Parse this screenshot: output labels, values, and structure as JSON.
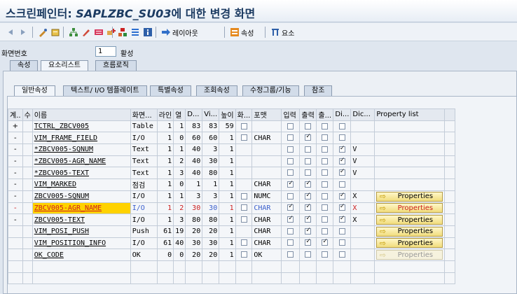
{
  "window": {
    "title_prefix": "스크린페인터:",
    "title_program": "SAPLZBC_SU03",
    "title_suffix": "에 대한 변경 화면"
  },
  "toolbar": {
    "layout_label": "레이아웃",
    "attributes_label": "속성",
    "elements_label": "요소"
  },
  "screen": {
    "number_label": "화면번호",
    "number_value": "1",
    "status": "활성"
  },
  "main_tabs": [
    "속성",
    "요소리스트",
    "흐름로직"
  ],
  "sub_tabs": [
    "일반속성",
    "텍스트/ I/O 템플레이트",
    "특별속성",
    "조회속성",
    "수정그룹/기능",
    "참조"
  ],
  "columns": [
    "계..",
    "수",
    "이름",
    "화면...",
    "라인",
    "열",
    "D...",
    "Vi...",
    "높이",
    "화...",
    "포맷",
    "입력",
    "출력",
    "출...",
    "Di...",
    "Dic...",
    "Property list"
  ],
  "property_button_label": "Properties",
  "rows": [
    {
      "mark": "+",
      "name": "TCTRL_ZBCV005",
      "type": "Table",
      "line": "1",
      "col": "1",
      "d": "83",
      "vi": "83",
      "h": "59",
      "hw": false,
      "fmt": "",
      "inp": false,
      "out": false,
      "oo": false,
      "di": false,
      "dic": "",
      "props": false
    },
    {
      "mark": "-",
      "name": "VIM_FRAME_FIELD",
      "type": "I/O",
      "line": "1",
      "col": "0",
      "d": "60",
      "vi": "60",
      "h": "1",
      "hw": false,
      "fmt": "CHAR",
      "inp": false,
      "out": true,
      "oo": false,
      "di": false,
      "dic": "",
      "props": false
    },
    {
      "mark": "-",
      "name": "*ZBCV005-SQNUM",
      "type": "Text",
      "line": "1",
      "col": "1",
      "d": "40",
      "vi": "3",
      "h": "1",
      "hw": null,
      "fmt": "",
      "inp": false,
      "out": false,
      "oo": false,
      "di": true,
      "dic": "V",
      "props": false
    },
    {
      "mark": "-",
      "name": "*ZBCV005-AGR_NAME",
      "type": "Text",
      "line": "1",
      "col": "2",
      "d": "40",
      "vi": "30",
      "h": "1",
      "hw": null,
      "fmt": "",
      "inp": false,
      "out": false,
      "oo": false,
      "di": true,
      "dic": "V",
      "props": false
    },
    {
      "mark": "-",
      "name": "*ZBCV005-TEXT",
      "type": "Text",
      "line": "1",
      "col": "3",
      "d": "40",
      "vi": "80",
      "h": "1",
      "hw": null,
      "fmt": "",
      "inp": false,
      "out": false,
      "oo": false,
      "di": true,
      "dic": "V",
      "props": false
    },
    {
      "mark": "-",
      "name": "VIM_MARKED",
      "type": "점검",
      "line": "1",
      "col": "0",
      "d": "1",
      "vi": "1",
      "h": "1",
      "hw": null,
      "fmt": "CHAR",
      "inp": true,
      "out": true,
      "oo": false,
      "di": false,
      "dic": "",
      "props": false
    },
    {
      "mark": "-",
      "name": "ZBCV005-SQNUM",
      "type": "I/O",
      "line": "1",
      "col": "1",
      "d": "3",
      "vi": "3",
      "h": "1",
      "hw": false,
      "fmt": "NUMC",
      "inp": false,
      "out": true,
      "oo": false,
      "di": true,
      "dic": "X",
      "props": true
    },
    {
      "mark": "-",
      "name": "ZBCV005-AGR_NAME",
      "type": "I/O",
      "line": "1",
      "col": "2",
      "d": "30",
      "vi": "30",
      "h": "1",
      "hw": false,
      "fmt": "CHAR",
      "inp": true,
      "out": true,
      "oo": false,
      "di": true,
      "dic": "X",
      "props": true,
      "selected": true
    },
    {
      "mark": "-",
      "name": "ZBCV005-TEXT",
      "type": "I/O",
      "line": "1",
      "col": "3",
      "d": "80",
      "vi": "80",
      "h": "1",
      "hw": false,
      "fmt": "CHAR",
      "inp": true,
      "out": true,
      "oo": false,
      "di": true,
      "dic": "X",
      "props": true
    },
    {
      "mark": "",
      "name": "VIM_POSI_PUSH",
      "type": "Push",
      "line": "61",
      "col": "19",
      "d": "20",
      "vi": "20",
      "h": "1",
      "hw": null,
      "fmt": "CHAR",
      "inp": false,
      "out": true,
      "oo": false,
      "di": false,
      "dic": "",
      "props": true
    },
    {
      "mark": "",
      "name": "VIM_POSITION_INFO",
      "type": "I/O",
      "line": "61",
      "col": "40",
      "d": "30",
      "vi": "30",
      "h": "1",
      "hw": false,
      "fmt": "CHAR",
      "inp": false,
      "out": true,
      "oo": true,
      "di": false,
      "dic": "",
      "props": true
    },
    {
      "mark": "",
      "name": "OK_CODE",
      "type": "OK",
      "line": "0",
      "col": "0",
      "d": "20",
      "vi": "20",
      "h": "1",
      "hw": false,
      "fmt": "OK",
      "inp": false,
      "out": false,
      "oo": false,
      "di": false,
      "dic": "",
      "props": "disabled"
    }
  ],
  "colors": {
    "accent_title": "#1c3b62",
    "selected_row": "#ffd200",
    "selected_text": "#cc1f1f"
  }
}
